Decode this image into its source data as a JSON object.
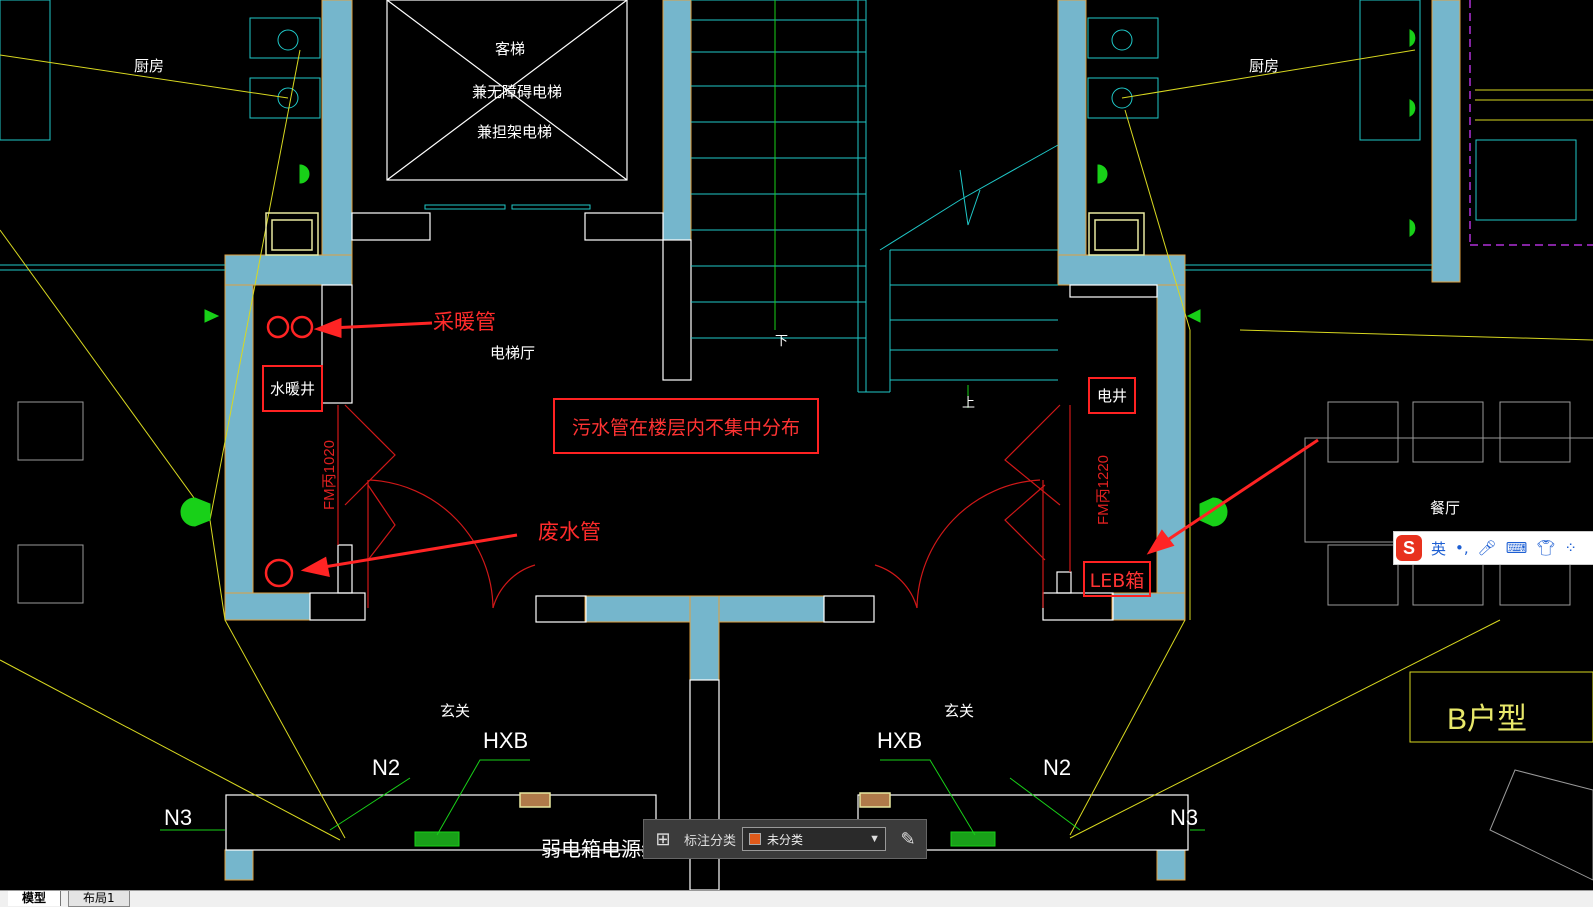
{
  "cad_labels": {
    "kitchen_left": "厨房",
    "kitchen_right": "厨房",
    "elevator_1": "客梯",
    "elevator_2": "兼无障碍电梯",
    "elevator_3": "兼担架电梯",
    "elevator_hall": "电梯厅",
    "stair_down": "下",
    "stair_up": "上",
    "dining": "餐厅",
    "entry_left": "玄关",
    "entry_right": "玄关",
    "hxb_left": "HXB",
    "hxb_right": "HXB",
    "n2_left": "N2",
    "n2_right": "N2",
    "n3_left": "N3",
    "n3_right": "N3",
    "unit_type": "B户型",
    "weak_box_line": "弱电箱电源线",
    "door_left": "FM丙1020",
    "door_right": "FM丙1220",
    "water_well": "水暖井",
    "elec_well": "电井"
  },
  "annotations": {
    "heating_pipe": "采暖管",
    "waste_water_pipe": "废水管",
    "sewage_note": "污水管在楼层内不集中分布",
    "leb_box": "LEB箱"
  },
  "toolbar": {
    "label": "标注分类",
    "selected": "未分类",
    "swatch_color": "#e05a1a"
  },
  "ime": {
    "lang": "英",
    "punct": "•,"
  },
  "tabs": [
    {
      "label": "模型",
      "active": true
    },
    {
      "label": "布局1",
      "active": false
    }
  ]
}
